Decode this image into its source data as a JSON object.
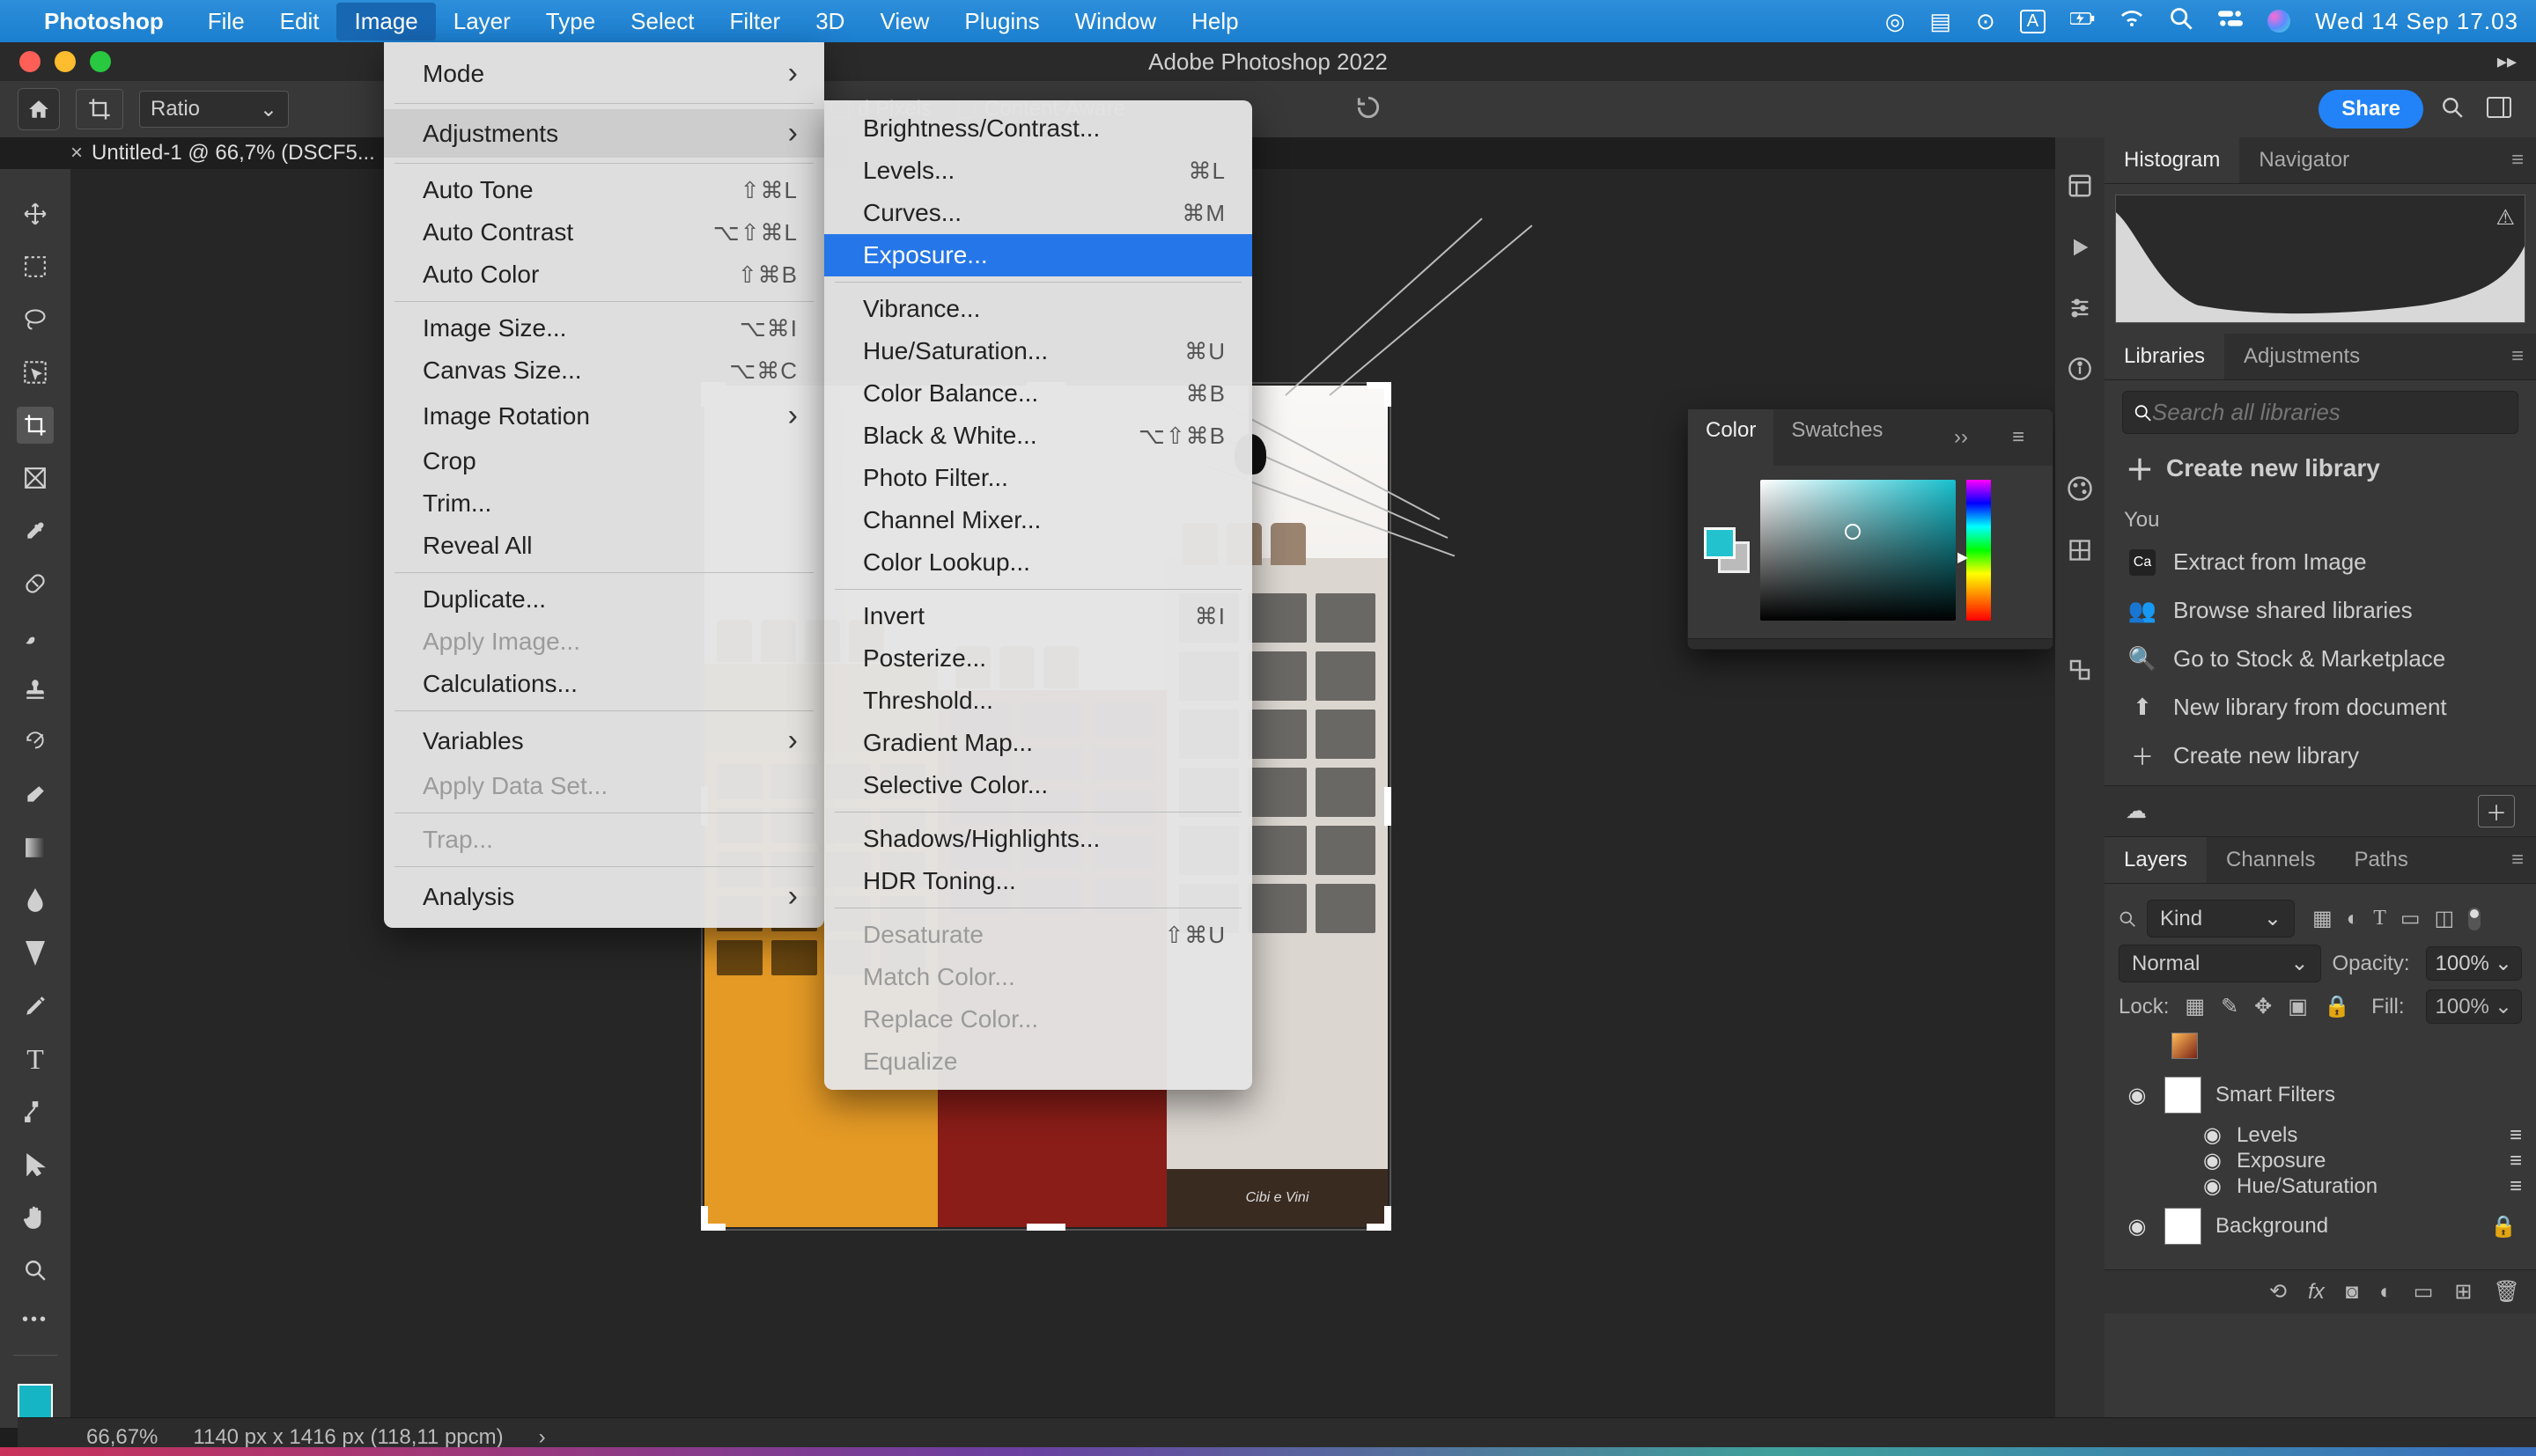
{
  "menubar": {
    "app_name": "Photoshop",
    "menus": [
      "File",
      "Edit",
      "Image",
      "Layer",
      "Type",
      "Select",
      "Filter",
      "3D",
      "View",
      "Plugins",
      "Window",
      "Help"
    ],
    "selected_menu": "Image",
    "clock": "Wed 14 Sep  17.03"
  },
  "window": {
    "title": "Adobe Photoshop 2022"
  },
  "options": {
    "ratio_label": "Ratio",
    "pixels_label": "Pixels",
    "content_aware_label": "Content-Aware",
    "share_label": "Share"
  },
  "tab": {
    "label": "Untitled-1 @ 66,7% (DSCF5..."
  },
  "status": {
    "zoom": "66,67%",
    "dims": "1140 px x 1416 px (118,11 ppcm)"
  },
  "image_menu": {
    "items": [
      {
        "label": "Mode",
        "arrow": true
      },
      {
        "sep": true
      },
      {
        "label": "Adjustments",
        "arrow": true,
        "hover": true
      },
      {
        "sep": true
      },
      {
        "label": "Auto Tone",
        "sc": "⇧⌘L"
      },
      {
        "label": "Auto Contrast",
        "sc": "⌥⇧⌘L"
      },
      {
        "label": "Auto Color",
        "sc": "⇧⌘B"
      },
      {
        "sep": true
      },
      {
        "label": "Image Size...",
        "sc": "⌥⌘I"
      },
      {
        "label": "Canvas Size...",
        "sc": "⌥⌘C"
      },
      {
        "label": "Image Rotation",
        "arrow": true
      },
      {
        "label": "Crop"
      },
      {
        "label": "Trim..."
      },
      {
        "label": "Reveal All"
      },
      {
        "sep": true
      },
      {
        "label": "Duplicate..."
      },
      {
        "label": "Apply Image...",
        "dis": true
      },
      {
        "label": "Calculations..."
      },
      {
        "sep": true
      },
      {
        "label": "Variables",
        "arrow": true
      },
      {
        "label": "Apply Data Set...",
        "dis": true
      },
      {
        "sep": true
      },
      {
        "label": "Trap...",
        "dis": true
      },
      {
        "sep": true
      },
      {
        "label": "Analysis",
        "arrow": true
      }
    ]
  },
  "adjust_menu": {
    "items": [
      {
        "label": "Brightness/Contrast..."
      },
      {
        "label": "Levels...",
        "sc": "⌘L"
      },
      {
        "label": "Curves...",
        "sc": "⌘M"
      },
      {
        "label": "Exposure...",
        "selected": true
      },
      {
        "sep": true
      },
      {
        "label": "Vibrance..."
      },
      {
        "label": "Hue/Saturation...",
        "sc": "⌘U"
      },
      {
        "label": "Color Balance...",
        "sc": "⌘B"
      },
      {
        "label": "Black & White...",
        "sc": "⌥⇧⌘B"
      },
      {
        "label": "Photo Filter..."
      },
      {
        "label": "Channel Mixer..."
      },
      {
        "label": "Color Lookup..."
      },
      {
        "sep": true
      },
      {
        "label": "Invert",
        "sc": "⌘I"
      },
      {
        "label": "Posterize..."
      },
      {
        "label": "Threshold..."
      },
      {
        "label": "Gradient Map..."
      },
      {
        "label": "Selective Color..."
      },
      {
        "sep": true
      },
      {
        "label": "Shadows/Highlights..."
      },
      {
        "label": "HDR Toning..."
      },
      {
        "sep": true
      },
      {
        "label": "Desaturate",
        "sc": "⇧⌘U",
        "dis": true
      },
      {
        "label": "Match Color...",
        "dis": true
      },
      {
        "label": "Replace Color...",
        "dis": true
      },
      {
        "label": "Equalize",
        "dis": true
      }
    ]
  },
  "panels": {
    "hist_tabs": [
      "Histogram",
      "Navigator"
    ],
    "lib_tabs": [
      "Libraries",
      "Adjustments"
    ],
    "search_placeholder": "Search all libraries",
    "create_label": "Create new library",
    "your_label": "You",
    "lib_items": [
      "Extract from Image",
      "Browse shared libraries",
      "Go to Stock & Marketplace",
      "New library from document",
      "Create new library"
    ],
    "layer_tabs": [
      "Layers",
      "Channels",
      "Paths"
    ],
    "kind": "Kind",
    "blend": "Normal",
    "opacity_lbl": "Opacity:",
    "opacity_val": "100%",
    "lock_lbl": "Lock:",
    "fill_lbl": "Fill:",
    "fill_val": "100%",
    "smart_filters": "Smart Filters",
    "filters": [
      "Levels",
      "Exposure",
      "Hue/Saturation"
    ],
    "background": "Background"
  },
  "color_panel": {
    "tabs": [
      "Color",
      "Swatches"
    ]
  },
  "doc": {
    "shop_sign": "Cibi e Vini"
  }
}
